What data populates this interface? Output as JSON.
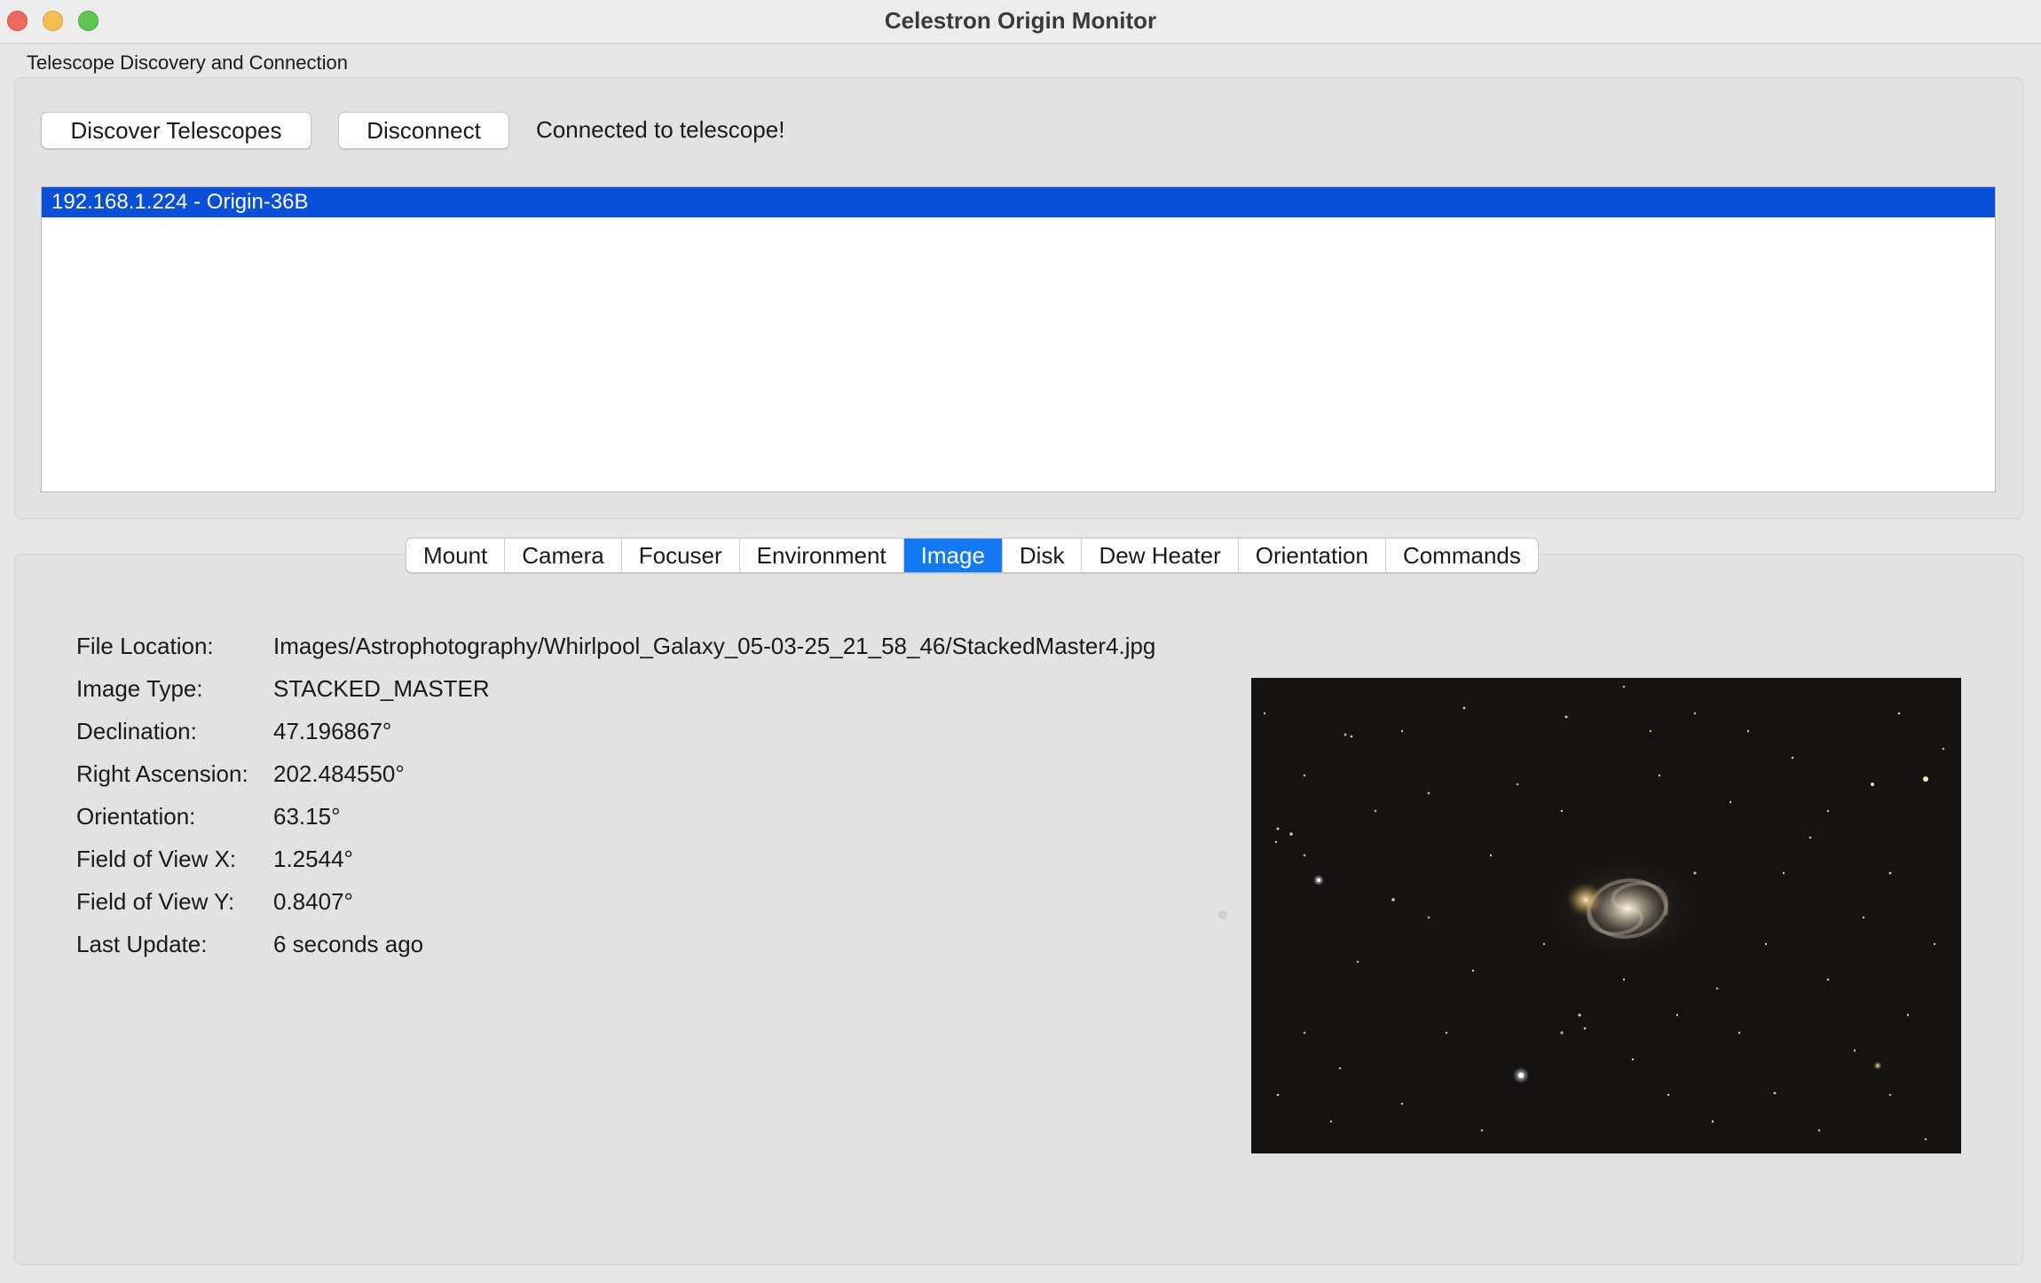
{
  "window": {
    "title": "Celestron Origin Monitor"
  },
  "discovery": {
    "group_label": "Telescope Discovery and Connection",
    "discover_label": "Discover Telescopes",
    "disconnect_label": "Disconnect",
    "status": "Connected to telescope!",
    "telescopes": [
      "192.168.1.224 - Origin-36B"
    ],
    "selected_index": 0
  },
  "tabs": [
    {
      "label": "Mount"
    },
    {
      "label": "Camera"
    },
    {
      "label": "Focuser"
    },
    {
      "label": "Environment"
    },
    {
      "label": "Image",
      "active": true
    },
    {
      "label": "Disk"
    },
    {
      "label": "Dew Heater"
    },
    {
      "label": "Orientation"
    },
    {
      "label": "Commands"
    }
  ],
  "image_info": [
    {
      "label": "File Location:",
      "value": "Images/Astrophotography/Whirlpool_Galaxy_05-03-25_21_58_46/StackedMaster4.jpg"
    },
    {
      "label": "Image Type:",
      "value": "STACKED_MASTER"
    },
    {
      "label": "Declination:",
      "value": "47.196867°"
    },
    {
      "label": "Right Ascension:",
      "value": "202.484550°"
    },
    {
      "label": "Orientation:",
      "value": "63.15°"
    },
    {
      "label": "Field of View X:",
      "value": "1.2544°"
    },
    {
      "label": "Field of View Y:",
      "value": "0.8407°"
    },
    {
      "label": "Last Update:",
      "value": "6 seconds ago"
    }
  ],
  "colors": {
    "selection": "#0a4fd8",
    "active_tab": "#1479f5",
    "close": "#ed6a5e",
    "minimize": "#f5bf4f",
    "maximize": "#61c554"
  }
}
